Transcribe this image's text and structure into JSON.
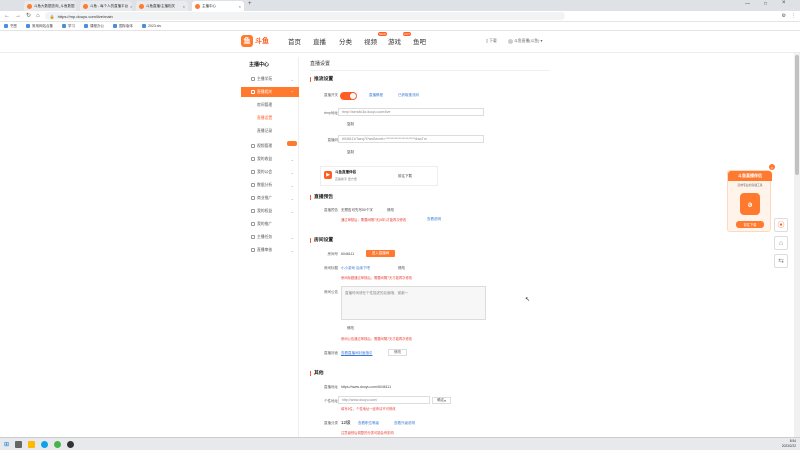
{
  "browser": {
    "tabs": [
      {
        "label": "斗鱼大数据查询_斗鱼数据"
      },
      {
        "label": "斗鱼 - 每个人的直播平台"
      },
      {
        "label": "斗鱼直播/主播相关"
      },
      {
        "label": "主播中心"
      }
    ],
    "url": "https://mp.douyu.com/live/main",
    "bookmarks": [
      "书签",
      "常用网站合集",
      "学习",
      "课程办公",
      "国际版本",
      "2023.xls"
    ]
  },
  "site": {
    "logo_text": "斗鱼",
    "nav": [
      "首页",
      "直播",
      "分类",
      "视频",
      "游戏",
      "鱼吧"
    ],
    "nav_badges": {
      "video": "NEW",
      "game": "HOT"
    },
    "header_right": [
      "下载",
      "斗鱼直播(斗鱼)"
    ]
  },
  "sidebar": {
    "title": "主播中心",
    "items": [
      {
        "label": "主播学苑"
      },
      {
        "label": "直播相关"
      },
      {
        "label": "视频管理"
      },
      {
        "label": "我的收益"
      },
      {
        "label": "我的公会"
      },
      {
        "label": "数据分析"
      },
      {
        "label": "商业推广"
      },
      {
        "label": "我的权益"
      },
      {
        "label": "我的推广"
      },
      {
        "label": "主播任务"
      },
      {
        "label": "直播审核"
      }
    ],
    "sub_items": [
      "房间管理",
      "直播设置",
      "直播记录"
    ]
  },
  "main": {
    "title": "直播设置",
    "sections": {
      "push": {
        "heading": "推流设置",
        "live_switch_label": "直播开关",
        "live_on": true,
        "links": [
          "直播教程",
          "已获取推流码"
        ],
        "rtmp_label": "rtmp地址",
        "rtmp_value": "rtmp://sendtc3a.douyu.com/live",
        "copy_label": "复制",
        "code_label": "直播码",
        "code_value": "6046111rTaeq7t?wsSecret=**********************&wsTm",
        "app_card_title": "斗鱼直播伴侣",
        "app_card_sub": "直播助手 更方便",
        "app_card_btn": "前往下载"
      },
      "notice": {
        "heading": "直播预告",
        "label": "直播预告",
        "value": "无预告可先写50个字",
        "edit_label": "修改",
        "warning": "通过审核后，需要间隔7天(6年)才能再次修改",
        "rule_link": "查看说明"
      },
      "room": {
        "heading": "房间设置",
        "room_id_label": "房间号",
        "room_id": "6046111",
        "enter_btn": "进入直播间",
        "title_label": "房间标题",
        "title_value": "小小游戏 后续下吧",
        "title_edit": "修改",
        "title_warning": "房间标题通过审核后，需要间隔7天才能再次修改",
        "notice_label": "房间公告",
        "notice_placeholder": "直播时间请在个性描述的后面哦，谢谢～",
        "notice_edit": "修改",
        "notice_warning": "房间公告通过审核后，需要间隔7天才能再次修改",
        "cover_label": "直播封面",
        "cover_link": "查看直播间封面指引",
        "cover_btn": "修改"
      },
      "other": {
        "heading": "其他",
        "addr_label": "直播地址",
        "addr_value": "https://www.douyu.com/6046111",
        "custom_label": "个性地址",
        "custom_placeholder": "http://www.douyu.com/",
        "custom_btn": "确定",
        "custom_hint": "填写6位，个性地址一经申请不可修改",
        "level_label": "直播分类",
        "level_value": "12级",
        "level_links": [
          "查看职位等级",
          "查看升级说明"
        ],
        "level_warning": "注意级别后调整的分类可能会有影响"
      }
    }
  },
  "float_ad": {
    "title": "斗鱼直播伴侣",
    "subtitle": "高效专业的直播工具",
    "app_glyph": "ǝ",
    "button": "前往下载",
    "close": "×"
  },
  "taskbar": {
    "time": "8:54",
    "date": "2023/2/22"
  },
  "colors": {
    "accent": "#ff7a2f",
    "link": "#3a7bd5",
    "warning": "#e8453c"
  }
}
